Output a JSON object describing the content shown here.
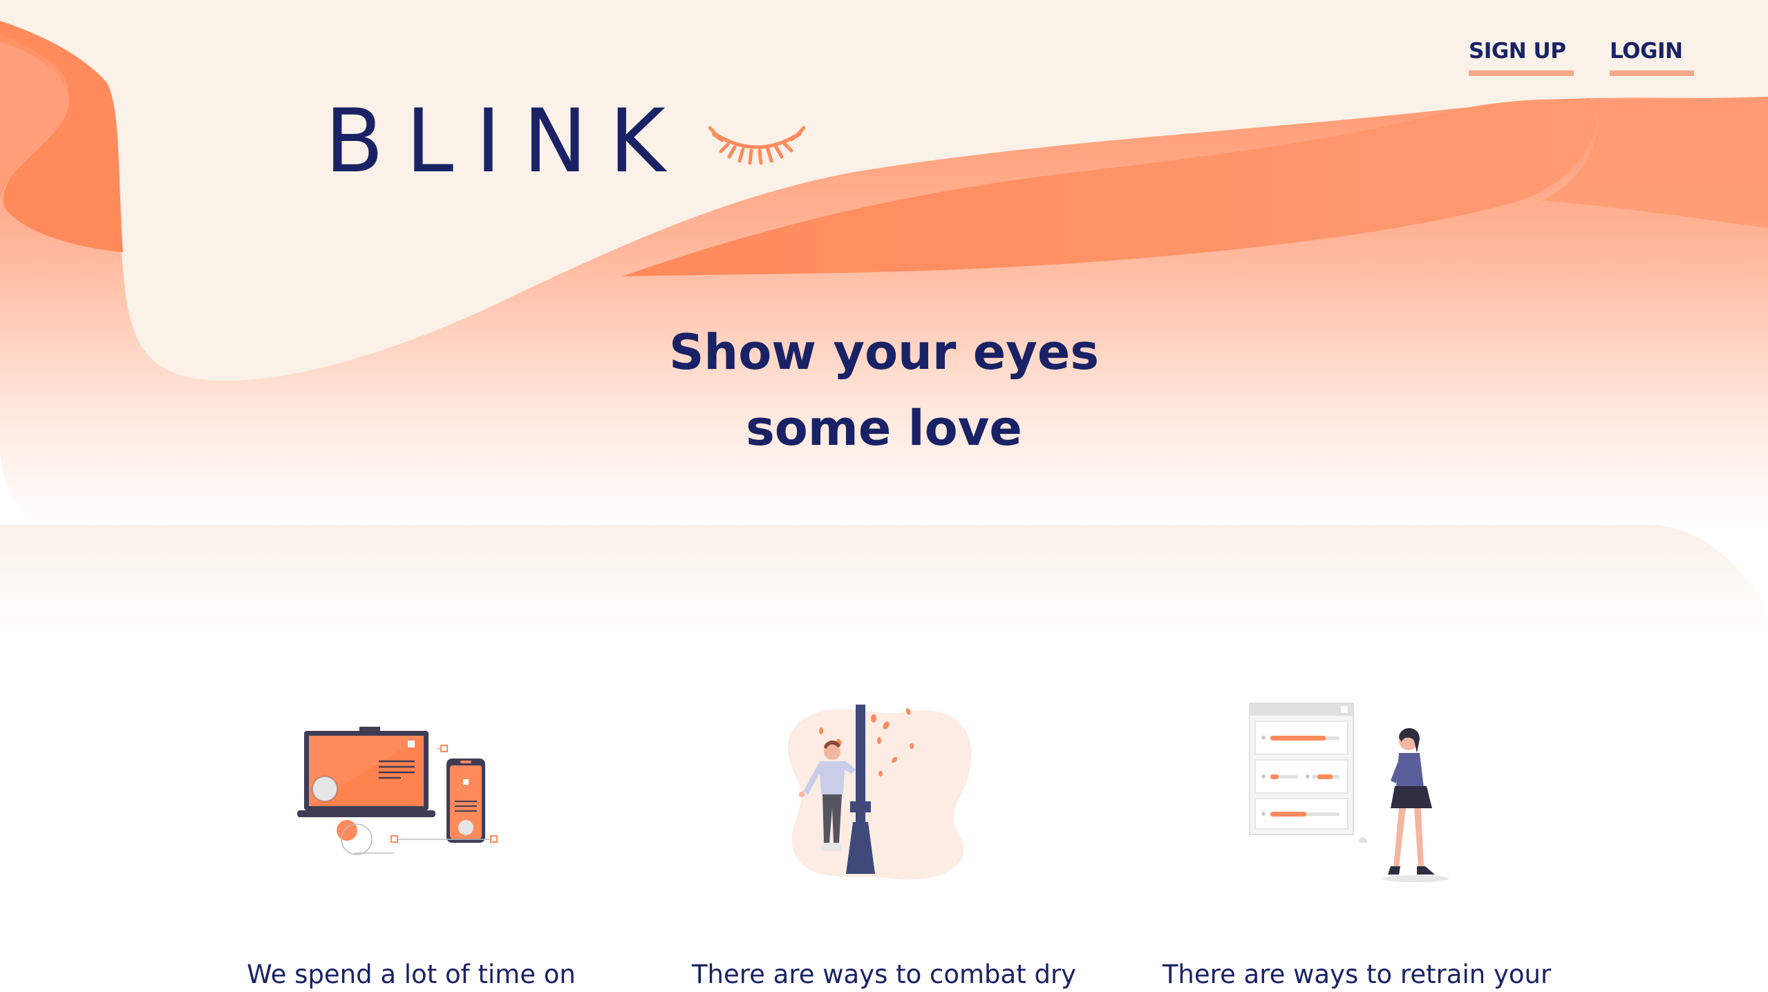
{
  "nav": {
    "signup_label": "SIGN UP",
    "login_label": "LOGIN"
  },
  "logo": {
    "text": "BLINK",
    "icon": "eyelash-icon"
  },
  "hero": {
    "headline_line1": "Show your eyes",
    "headline_line2": "some love"
  },
  "features": [
    {
      "icon": "devices-illustration",
      "text": "We spend a lot of time on"
    },
    {
      "icon": "person-lamppost-illustration",
      "text": "There are ways to combat dry"
    },
    {
      "icon": "woman-checklist-illustration",
      "text": "There are ways to retrain your"
    }
  ],
  "colors": {
    "navy": "#1a2266",
    "accent": "#ff8a5b",
    "cream": "#faf1e8",
    "underline": "#f5a788"
  }
}
